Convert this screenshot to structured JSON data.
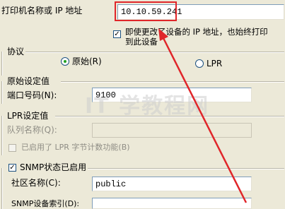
{
  "printer": {
    "name_label": "打印机名称或 IP 地址",
    "name_value": "10.10.59.241",
    "enable_bidir_label_line1": "即使更改了设备的 IP 地址，也始终打印",
    "enable_bidir_label_line2": "到此设备",
    "enable_bidir_checked": "✓"
  },
  "protocol": {
    "group_label": "协议",
    "raw_label": "原始(R)",
    "lpr_label": "LPR"
  },
  "raw_settings": {
    "group_label": "原始设定值",
    "port_label": "端口号码(N):",
    "port_value": "9100"
  },
  "lpr_settings": {
    "group_label": "LPR设定值",
    "queue_label": "队列名称(Q):",
    "byte_count_label": "已启用了 LPR 字节计数功能(B)"
  },
  "snmp": {
    "status_label": "SNMP状态已启用",
    "status_checked": "✓",
    "community_label": "社区名称(C):",
    "community_value": "public",
    "device_index_label": "SNMP设备索引(D):"
  },
  "overlay": {
    "watermark_text": "IT 学教程网",
    "highlight_color": "#e0262a"
  }
}
